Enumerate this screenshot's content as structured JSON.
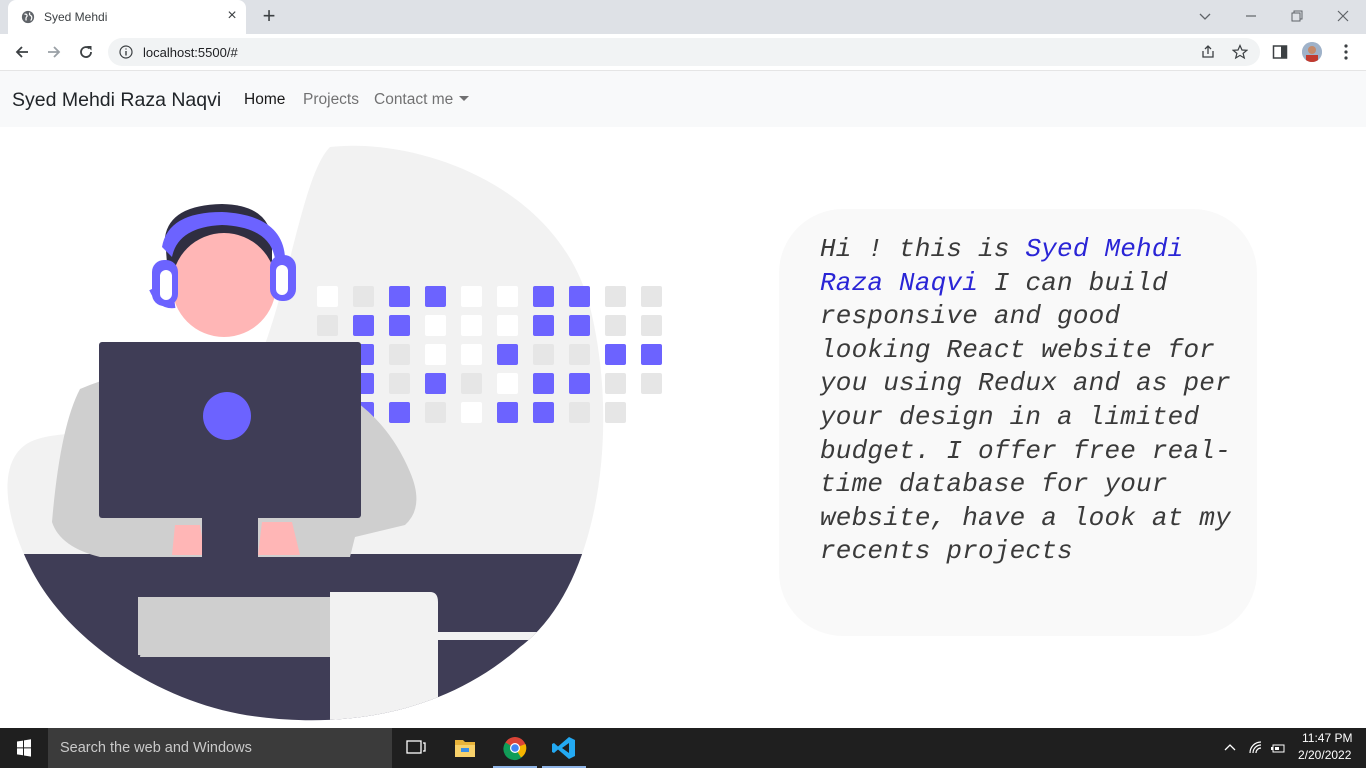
{
  "browser": {
    "tab_title": "Syed Mehdi",
    "url": "localhost:5500/#"
  },
  "navbar": {
    "brand": "Syed Mehdi Raza Naqvi",
    "links": [
      {
        "label": "Home",
        "active": true
      },
      {
        "label": "Projects",
        "active": false
      },
      {
        "label": "Contact me",
        "active": false,
        "dropdown": true
      }
    ]
  },
  "intro": {
    "prefix": "Hi ! this is ",
    "name": "Syed Mehdi Raza Naqvi",
    "body": " I can build responsive and good looking React website for you using Redux and as per your design in a limited budget. I offer free real-time database for your website, have a look at my recents projects"
  },
  "taskbar": {
    "search_placeholder": "Search the web and Windows",
    "time": "11:47 PM",
    "date": "2/20/2022"
  },
  "colors": {
    "accent": "#6c63ff",
    "name_highlight": "#2a25d6",
    "navbar_bg": "#f8f9fa",
    "monitor": "#3f3d56"
  },
  "icons": [
    "globe-icon",
    "close-icon",
    "plus-icon",
    "back-icon",
    "forward-icon",
    "reload-icon",
    "info-icon",
    "share-icon",
    "star-icon",
    "side-panel-icon",
    "menu-icon",
    "windows-icon",
    "task-view-icon",
    "file-explorer-icon",
    "chrome-icon",
    "vscode-icon"
  ]
}
